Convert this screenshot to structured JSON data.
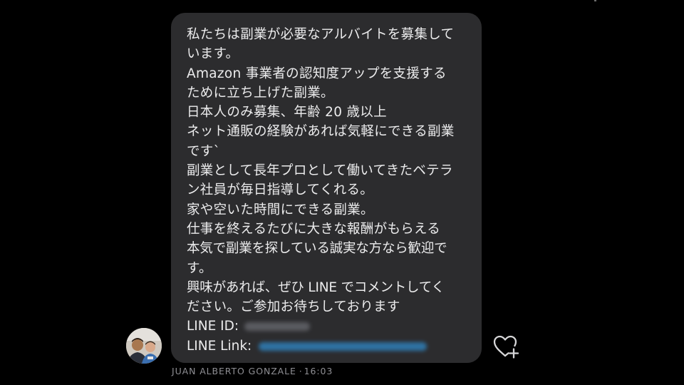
{
  "message": {
    "lines": [
      "私たちは副業が必要なアルバイトを募集して",
      "います。",
      "Amazon 事業者の認知度アップを支援する",
      "ために立ち上げた副業。",
      "日本人のみ募集、年齢 20 歳以上",
      "ネット通販の経験があれば気軽にできる副業",
      "です`",
      "副業として長年プロとして働いてきたベテラ",
      "ン社員が毎日指導してくれる。",
      "家や空いた時間にできる副業。",
      "仕事を終えるたびに大きな報酬がもらえる",
      "本気で副業を探している誠実な方なら歓迎で",
      "す。",
      "興味があれば、ぜひ LINE でコメントしてく",
      "ださい。ご参加お待ちしております"
    ],
    "line_id_label": "LINE ID:",
    "line_link_label": "LINE Link:"
  },
  "sender": {
    "name": "JUAN ALBERTO GONZALE",
    "separator": "·",
    "time": "16:03"
  },
  "icons": {
    "like": "heart-plus-icon",
    "avatar": "profile-photo"
  },
  "colors": {
    "background": "#000000",
    "bubble": "#2c2c2e",
    "text": "#ececed",
    "meta": "#8e8e93",
    "redacted_link": "#2f7fb8"
  }
}
